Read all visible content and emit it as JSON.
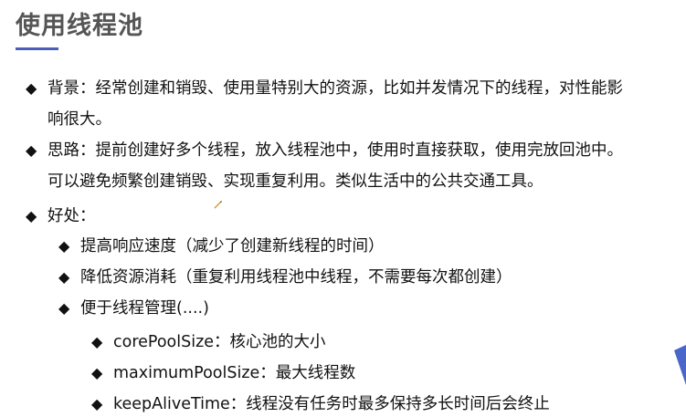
{
  "title": "使用线程池",
  "accent_color": "#4a5fb8",
  "bullet_glyph": "◆",
  "items": {
    "background": {
      "line1": "背景：经常创建和销毁、使用量特别大的资源，比如并发情况下的线程，对性能影",
      "line2": "响很大。"
    },
    "idea": {
      "line1": "思路：提前创建好多个线程，放入线程池中，使用时直接获取，使用完放回池中。",
      "line2": "可以避免频繁创建销毁、实现重复利用。类似生活中的公共交通工具。"
    },
    "benefits": {
      "label": "好处：",
      "sub": [
        "提高响应速度（减少了创建新线程的时间）",
        "降低资源消耗（重复利用线程池中线程，不需要每次都创建）",
        "便于线程管理(....)"
      ],
      "params": [
        "corePoolSize：核心池的大小",
        "maximumPoolSize：最大线程数",
        "keepAliveTime：线程没有任务时最多保持多长时间后会终止"
      ]
    }
  },
  "icons": {
    "bullet": "diamond-icon",
    "pen_cursor": "pen-cursor-icon",
    "corner": "corner-triangle-decoration"
  }
}
